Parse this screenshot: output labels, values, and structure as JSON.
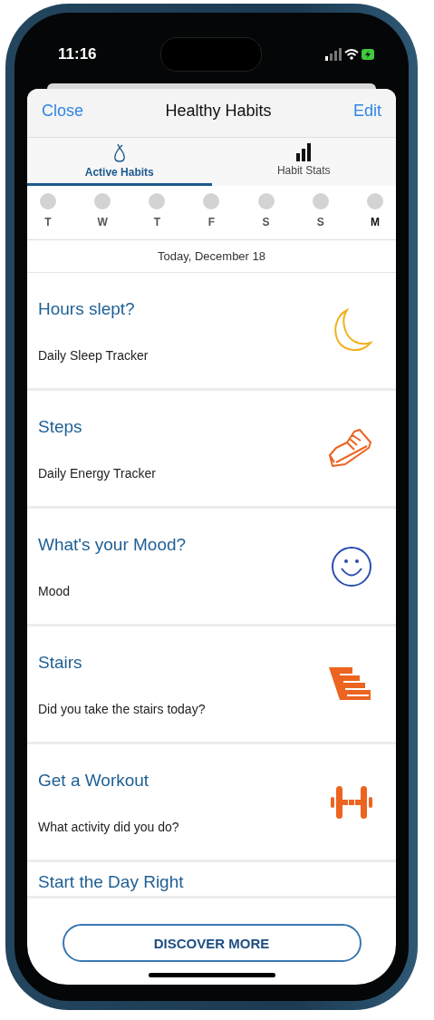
{
  "status_bar": {
    "time": "11:16"
  },
  "header": {
    "left_action": "Close",
    "title": "Healthy Habits",
    "right_action": "Edit"
  },
  "tabs": [
    {
      "label": "Active Habits",
      "kind": "pear",
      "selected": true
    },
    {
      "label": "Habit Stats",
      "kind": "bars",
      "selected": false
    }
  ],
  "days": [
    {
      "label": "T",
      "selected": false
    },
    {
      "label": "W",
      "selected": false
    },
    {
      "label": "T",
      "selected": false
    },
    {
      "label": "F",
      "selected": false
    },
    {
      "label": "S",
      "selected": false
    },
    {
      "label": "S",
      "selected": false
    },
    {
      "label": "M",
      "selected": true
    }
  ],
  "date_label": "Today, December 18",
  "habits": [
    {
      "title": "Hours slept?",
      "subtitle": "Daily Sleep Tracker",
      "kind": "sleep"
    },
    {
      "title": "Steps",
      "subtitle": "Daily Energy Tracker",
      "kind": "steps"
    },
    {
      "title": "What's your Mood?",
      "subtitle": "Mood",
      "kind": "mood"
    },
    {
      "title": "Stairs",
      "subtitle": "Did you take the stairs today?",
      "kind": "stairs"
    },
    {
      "title": "Get a Workout",
      "subtitle": "What activity did you do?",
      "kind": "workout"
    },
    {
      "title": "Start the Day Right",
      "kind": "none"
    }
  ],
  "discover_button": "DISCOVER MORE"
}
